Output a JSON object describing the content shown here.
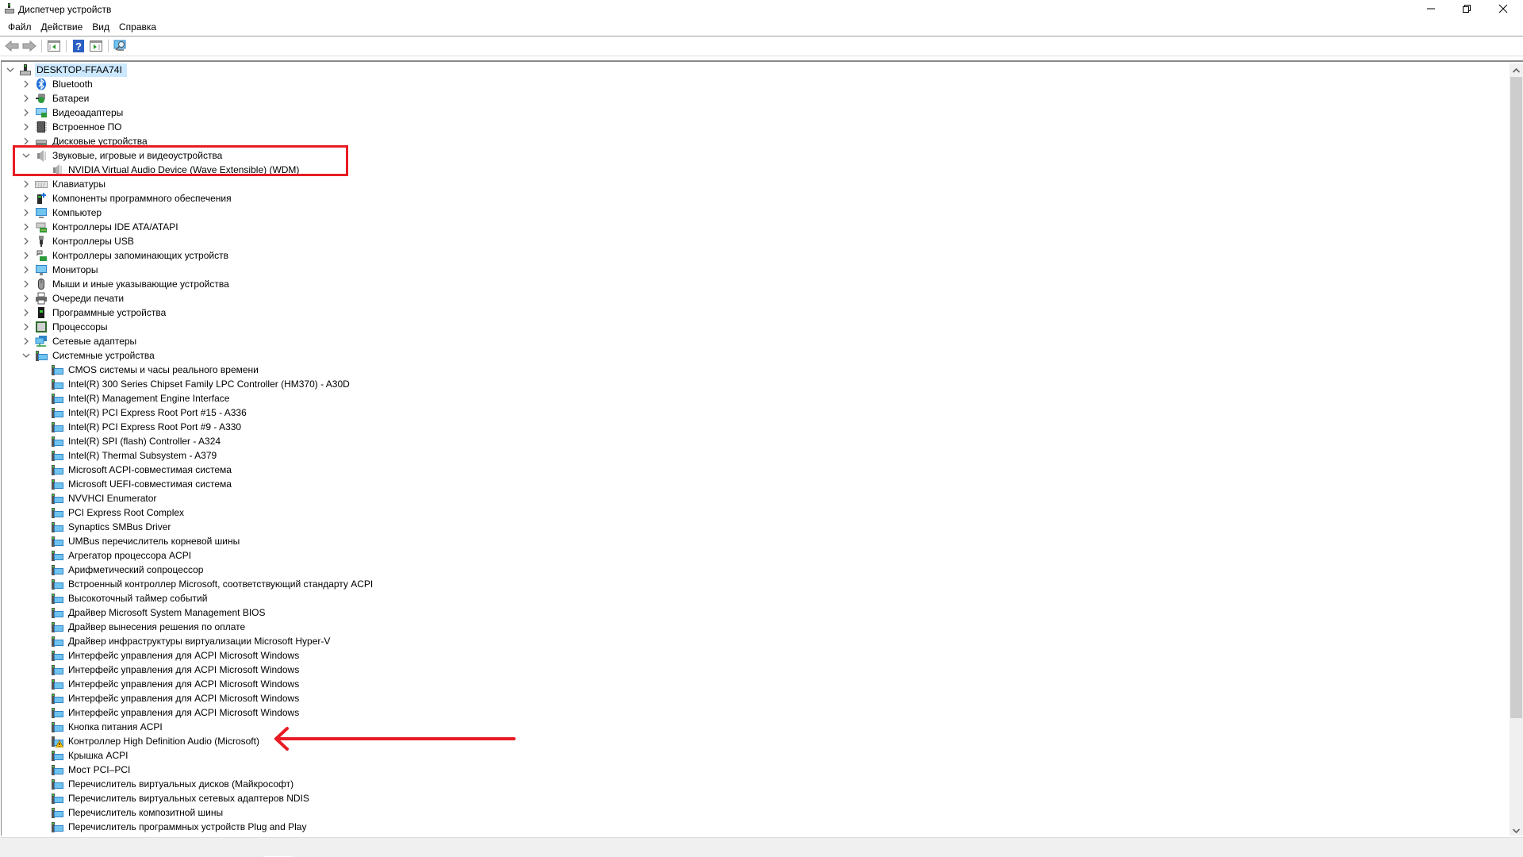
{
  "window": {
    "title": "Диспетчер устройств",
    "icon": "device-manager-icon",
    "controls": {
      "minimize": "minimize-icon",
      "maximize": "restore-icon",
      "close": "close-icon"
    }
  },
  "menu": [
    "Файл",
    "Действие",
    "Вид",
    "Справка"
  ],
  "toolbar": [
    "back-arrow-icon",
    "forward-arrow-icon",
    "show-hide-console-tree-icon",
    "help-icon",
    "show-hide-action-pane-icon",
    "scan-hardware-changes-icon"
  ],
  "tree": {
    "root": {
      "label": "DESKTOP-FFAA74I",
      "icon": "computer-tower-icon",
      "expanded": true,
      "selected": true
    },
    "categories": [
      {
        "label": "Bluetooth",
        "icon": "bluetooth-icon",
        "expanded": false
      },
      {
        "label": "Батареи",
        "icon": "battery-icon",
        "expanded": false
      },
      {
        "label": "Видеоадаптеры",
        "icon": "display-adapter-icon",
        "expanded": false
      },
      {
        "label": "Встроенное ПО",
        "icon": "firmware-chip-icon",
        "expanded": false
      },
      {
        "label": "Дисковые устройства",
        "icon": "disk-drive-icon",
        "expanded": false
      },
      {
        "label": "Звуковые, игровые и видеоустройства",
        "icon": "speaker-icon",
        "expanded": true,
        "children": [
          {
            "label": "NVIDIA Virtual Audio Device (Wave Extensible) (WDM)",
            "icon": "speaker-icon"
          }
        ]
      },
      {
        "label": "Клавиатуры",
        "icon": "keyboard-icon",
        "expanded": false
      },
      {
        "label": "Компоненты программного обеспечения",
        "icon": "software-component-icon",
        "expanded": false
      },
      {
        "label": "Компьютер",
        "icon": "computer-monitor-icon",
        "expanded": false
      },
      {
        "label": "Контроллеры IDE ATA/ATAPI",
        "icon": "ide-controller-icon",
        "expanded": false
      },
      {
        "label": "Контроллеры USB",
        "icon": "usb-icon",
        "expanded": false
      },
      {
        "label": "Контроллеры запоминающих устройств",
        "icon": "storage-controller-icon",
        "expanded": false
      },
      {
        "label": "Мониторы",
        "icon": "monitor-icon",
        "expanded": false
      },
      {
        "label": "Мыши и иные указывающие устройства",
        "icon": "mouse-icon",
        "expanded": false
      },
      {
        "label": "Очереди печати",
        "icon": "printer-icon",
        "expanded": false
      },
      {
        "label": "Программные устройства",
        "icon": "software-device-icon",
        "expanded": false
      },
      {
        "label": "Процессоры",
        "icon": "processor-icon",
        "expanded": false
      },
      {
        "label": "Сетевые адаптеры",
        "icon": "network-adapter-icon",
        "expanded": false
      },
      {
        "label": "Системные устройства",
        "icon": "system-device-icon",
        "expanded": true,
        "children": [
          {
            "label": "CMOS системы и часы реального времени",
            "icon": "system-device-icon"
          },
          {
            "label": "Intel(R) 300 Series Chipset Family LPC Controller (HM370) - A30D",
            "icon": "system-device-icon"
          },
          {
            "label": "Intel(R) Management Engine Interface",
            "icon": "system-device-icon"
          },
          {
            "label": "Intel(R) PCI Express Root Port #15 - A336",
            "icon": "system-device-icon"
          },
          {
            "label": "Intel(R) PCI Express Root Port #9 - A330",
            "icon": "system-device-icon"
          },
          {
            "label": "Intel(R) SPI (flash) Controller - A324",
            "icon": "system-device-icon"
          },
          {
            "label": "Intel(R) Thermal Subsystem - A379",
            "icon": "system-device-icon"
          },
          {
            "label": "Microsoft ACPI-совместимая система",
            "icon": "system-device-icon"
          },
          {
            "label": "Microsoft UEFI-совместимая система",
            "icon": "system-device-icon"
          },
          {
            "label": "NVVHCI Enumerator",
            "icon": "system-device-icon"
          },
          {
            "label": "PCI Express Root Complex",
            "icon": "system-device-icon"
          },
          {
            "label": "Synaptics SMBus Driver",
            "icon": "system-device-icon"
          },
          {
            "label": "UMBus перечислитель корневой шины",
            "icon": "system-device-icon"
          },
          {
            "label": "Агрегатор процессора ACPI",
            "icon": "system-device-icon"
          },
          {
            "label": "Арифметический сопроцессор",
            "icon": "system-device-icon"
          },
          {
            "label": "Встроенный контроллер Microsoft, соответствующий стандарту ACPI",
            "icon": "system-device-icon"
          },
          {
            "label": "Высокоточный таймер событий",
            "icon": "system-device-icon"
          },
          {
            "label": "Драйвер Microsoft System Management BIOS",
            "icon": "system-device-icon"
          },
          {
            "label": "Драйвер вынесения решения по оплате",
            "icon": "system-device-icon"
          },
          {
            "label": "Драйвер инфраструктуры виртуализации Microsoft Hyper-V",
            "icon": "system-device-icon"
          },
          {
            "label": "Интерфейс управления для ACPI Microsoft Windows",
            "icon": "system-device-icon"
          },
          {
            "label": "Интерфейс управления для ACPI Microsoft Windows",
            "icon": "system-device-icon"
          },
          {
            "label": "Интерфейс управления для ACPI Microsoft Windows",
            "icon": "system-device-icon"
          },
          {
            "label": "Интерфейс управления для ACPI Microsoft Windows",
            "icon": "system-device-icon"
          },
          {
            "label": "Интерфейс управления для ACPI Microsoft Windows",
            "icon": "system-device-icon"
          },
          {
            "label": "Кнопка питания ACPI",
            "icon": "system-device-icon"
          },
          {
            "label": "Контроллер High Definition Audio (Microsoft)",
            "icon": "system-device-warning-icon",
            "warning": true
          },
          {
            "label": "Крышка ACPI",
            "icon": "system-device-icon"
          },
          {
            "label": "Мост PCI–PCI",
            "icon": "system-device-icon"
          },
          {
            "label": "Перечислитель виртуальных дисков (Майкрософт)",
            "icon": "system-device-icon"
          },
          {
            "label": "Перечислитель виртуальных сетевых адаптеров NDIS",
            "icon": "system-device-icon"
          },
          {
            "label": "Перечислитель композитной шины",
            "icon": "system-device-icon"
          },
          {
            "label": "Перечислитель программных устройств Plug and Play",
            "icon": "system-device-icon"
          },
          {
            "label": "",
            "icon": "system-device-icon",
            "partially_visible": true
          }
        ]
      }
    ]
  },
  "annotations": {
    "highlight_box_color": "#e81c24",
    "arrow_color": "#e81c24",
    "highlighted_item": "Звуковые, игровые и видеоустройства",
    "arrow_target": "Контроллер High Definition Audio (Microsoft)"
  },
  "colors": {
    "selection": "#cce8ff",
    "accent_red": "#e81c24"
  }
}
